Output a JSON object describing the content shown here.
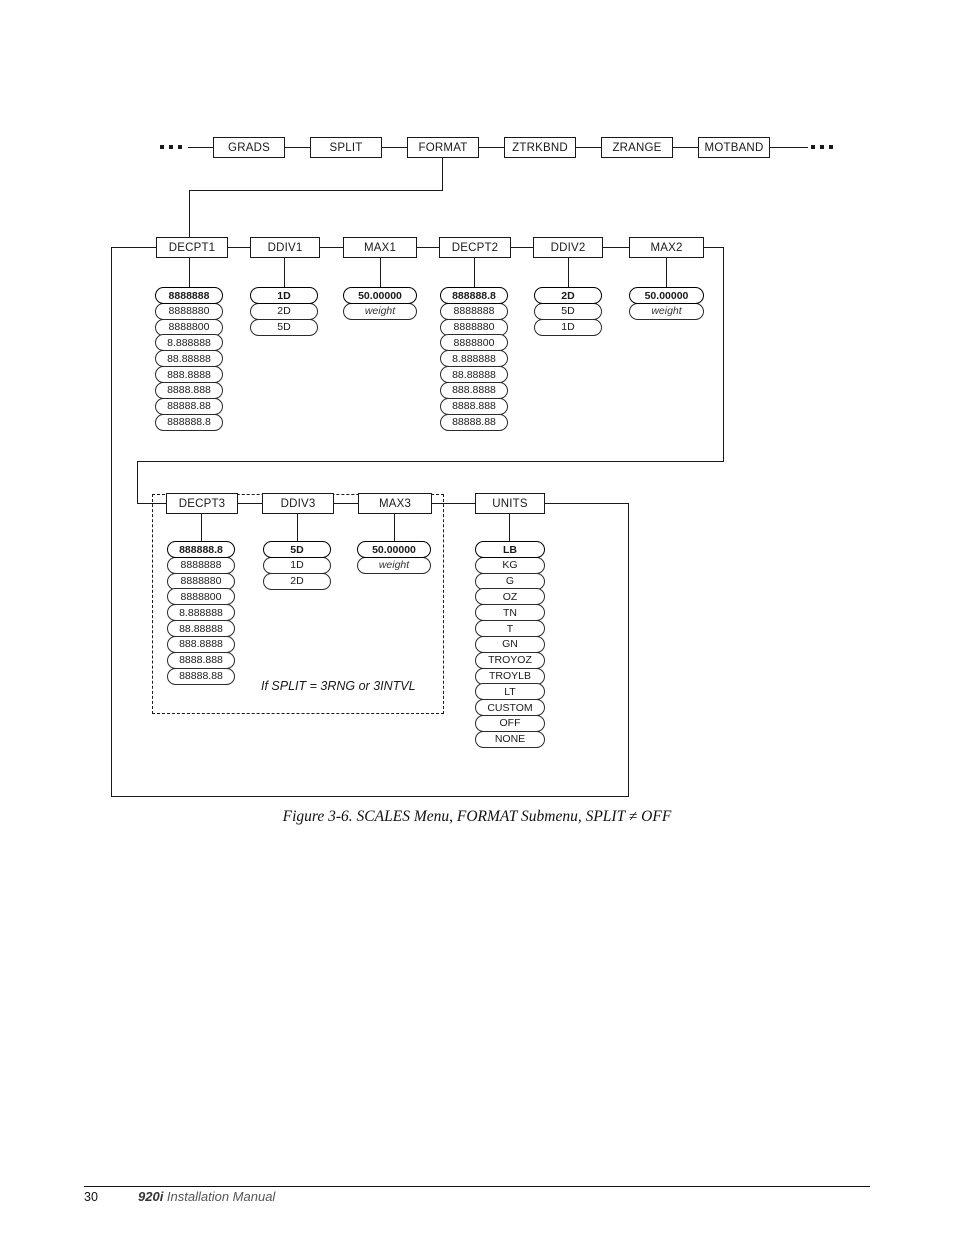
{
  "figure": {
    "caption": "Figure 3-6. SCALES Menu, FORMAT Submenu, SPLIT ≠ OFF",
    "note": "If SPLIT = 3RNG or 3INTVL",
    "ellipsis_left": "...",
    "ellipsis_right": "..."
  },
  "top_row": {
    "items": [
      {
        "label": "GRADS"
      },
      {
        "label": "SPLIT"
      },
      {
        "label": "FORMAT"
      },
      {
        "label": "ZTRKBND"
      },
      {
        "label": "ZRANGE"
      },
      {
        "label": "MOTBAND"
      }
    ]
  },
  "row2": {
    "columns": [
      {
        "label": "DECPT1",
        "values": [
          "8888888",
          "8888880",
          "8888800",
          "8.888888",
          "88.88888",
          "888.8888",
          "8888.888",
          "88888.88",
          "888888.8"
        ]
      },
      {
        "label": "DDIV1",
        "values": [
          "1D",
          "2D",
          "5D"
        ]
      },
      {
        "label": "MAX1",
        "values": [
          "50.00000",
          "weight"
        ]
      },
      {
        "label": "DECPT2",
        "values": [
          "888888.8",
          "8888888",
          "8888880",
          "8888800",
          "8.888888",
          "88.88888",
          "888.8888",
          "8888.888",
          "88888.88"
        ]
      },
      {
        "label": "DDIV2",
        "values": [
          "2D",
          "5D",
          "1D"
        ]
      },
      {
        "label": "MAX2",
        "values": [
          "50.00000",
          "weight"
        ]
      }
    ]
  },
  "row3": {
    "columns": [
      {
        "label": "DECPT3",
        "values": [
          "888888.8",
          "8888888",
          "8888880",
          "8888800",
          "8.888888",
          "88.88888",
          "888.8888",
          "8888.888",
          "88888.88"
        ]
      },
      {
        "label": "DDIV3",
        "values": [
          "5D",
          "1D",
          "2D"
        ]
      },
      {
        "label": "MAX3",
        "values": [
          "50.00000",
          "weight"
        ]
      },
      {
        "label": "UNITS",
        "values": [
          "LB",
          "KG",
          "G",
          "OZ",
          "TN",
          "T",
          "GN",
          "TROYOZ",
          "TROYLB",
          "LT",
          "CUSTOM",
          "OFF",
          "NONE"
        ]
      }
    ]
  },
  "footer": {
    "page_number": "30",
    "manual_bold": "920i",
    "manual_rest": " Installation Manual"
  }
}
